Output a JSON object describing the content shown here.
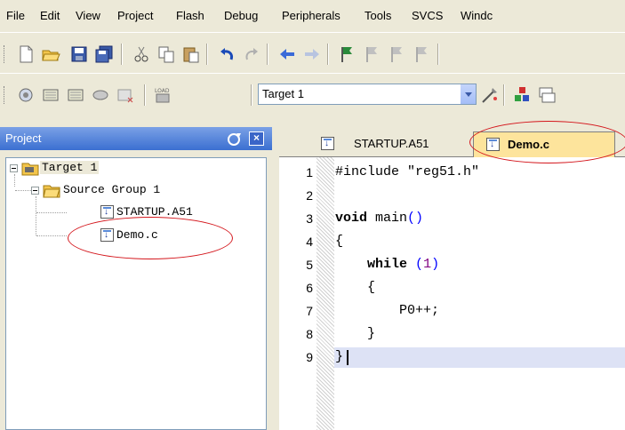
{
  "menu": [
    {
      "label": "File"
    },
    {
      "label": "Edit"
    },
    {
      "label": "View"
    },
    {
      "label": "Project"
    },
    {
      "label": "Flash"
    },
    {
      "label": "Debug"
    },
    {
      "label": "Peripherals"
    },
    {
      "label": "Tools"
    },
    {
      "label": "SVCS"
    },
    {
      "label": "Windc"
    }
  ],
  "toolbar2": {
    "target_value": "Target 1"
  },
  "project_panel": {
    "title": "Project",
    "tree": {
      "root": "Target 1",
      "group": "Source Group 1",
      "files": [
        "STARTUP.A51",
        "Demo.c"
      ]
    }
  },
  "tabs": [
    {
      "label": "STARTUP.A51",
      "active": false
    },
    {
      "label": "Demo.c",
      "active": true
    }
  ],
  "editor": {
    "lines": [
      {
        "n": "1"
      },
      {
        "n": "2"
      },
      {
        "n": "3"
      },
      {
        "n": "4"
      },
      {
        "n": "5"
      },
      {
        "n": "6"
      },
      {
        "n": "7"
      },
      {
        "n": "8"
      },
      {
        "n": "9"
      }
    ],
    "code": {
      "l1_directive": "#include",
      "l1_string": "\"reg51.h\"",
      "l3_kw": "void",
      "l3_rest": "main",
      "l3_parens": "()",
      "l4": "{",
      "l5_kw": "while",
      "l5_open": "(",
      "l5_num": "1",
      "l5_close": ")",
      "l6": "{",
      "l7": "P0++;",
      "l8": "}",
      "l9": "}"
    }
  },
  "colors": {
    "annotation": "#d4161c",
    "active_tab": "#fde49c",
    "panel_header": "#3b6fd1"
  }
}
